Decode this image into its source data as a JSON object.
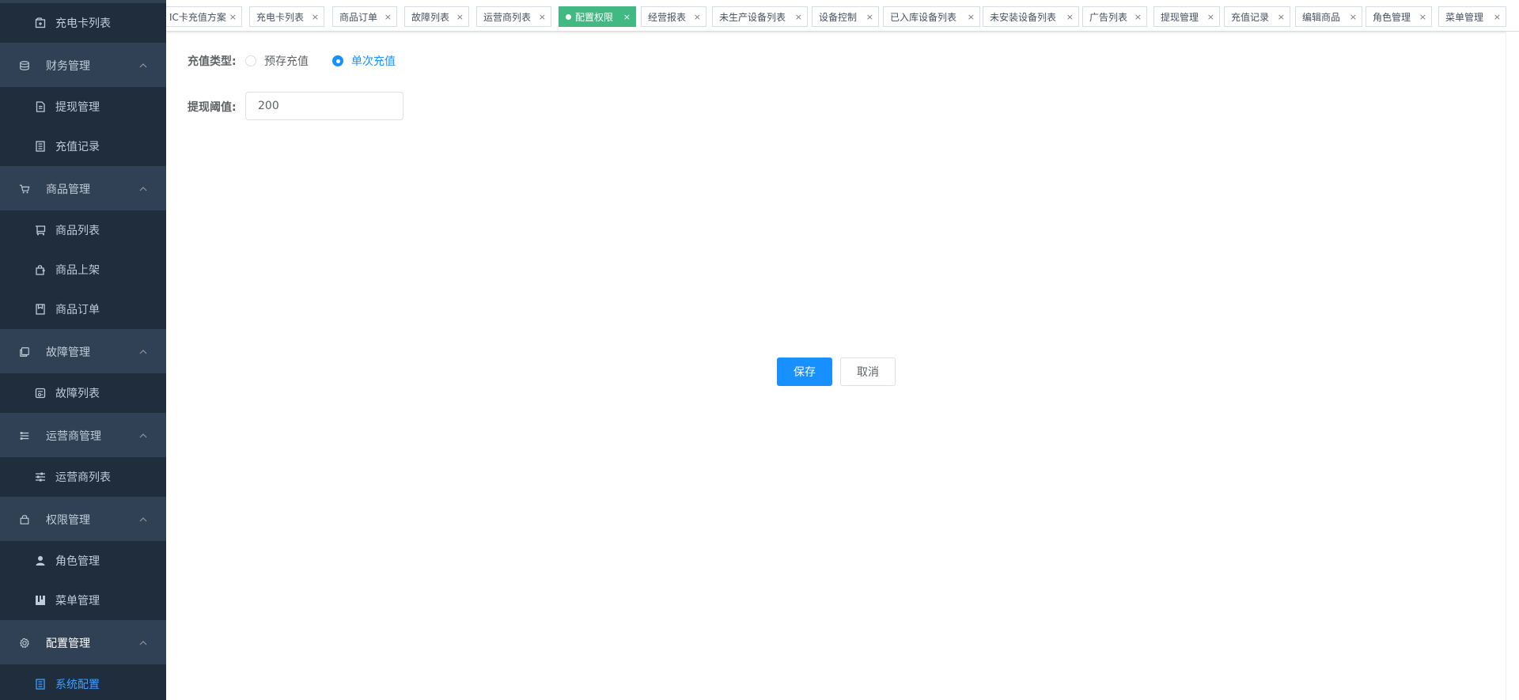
{
  "sidebar": {
    "items": [
      {
        "label": "充电卡列表",
        "icon": "card-list-icon"
      },
      {
        "label": "财务管理",
        "icon": "database-icon"
      },
      {
        "label": "提现管理",
        "icon": "document-icon"
      },
      {
        "label": "充值记录",
        "icon": "record-icon"
      },
      {
        "label": "商品管理",
        "icon": "cart-icon"
      },
      {
        "label": "商品列表",
        "icon": "cart-list-icon"
      },
      {
        "label": "商品上架",
        "icon": "shelf-icon"
      },
      {
        "label": "商品订单",
        "icon": "order-icon"
      },
      {
        "label": "故障管理",
        "icon": "copy-icon"
      },
      {
        "label": "故障列表",
        "icon": "fault-list-icon"
      },
      {
        "label": "运营商管理",
        "icon": "operator-icon"
      },
      {
        "label": "运营商列表",
        "icon": "sliders-icon"
      },
      {
        "label": "权限管理",
        "icon": "lock-icon"
      },
      {
        "label": "角色管理",
        "icon": "user-icon"
      },
      {
        "label": "菜单管理",
        "icon": "menu-icon"
      },
      {
        "label": "配置管理",
        "icon": "gear-icon"
      },
      {
        "label": "系统配置",
        "icon": "system-config-icon"
      }
    ]
  },
  "tags": [
    {
      "label": "IC卡充值方案"
    },
    {
      "label": "充电卡列表"
    },
    {
      "label": "商品订单"
    },
    {
      "label": "故障列表"
    },
    {
      "label": "运营商列表"
    },
    {
      "label": "配置权限"
    },
    {
      "label": "经营报表"
    },
    {
      "label": "未生产设备列表"
    },
    {
      "label": "设备控制"
    },
    {
      "label": "已入库设备列表"
    },
    {
      "label": "未安装设备列表"
    },
    {
      "label": "广告列表"
    },
    {
      "label": "提现管理"
    },
    {
      "label": "充值记录"
    },
    {
      "label": "编辑商品"
    },
    {
      "label": "角色管理"
    },
    {
      "label": "菜单管理"
    }
  ],
  "tag_close_glyph": "×",
  "form": {
    "recharge_type_label": "充值类型:",
    "recharge_options": [
      {
        "label": "预存充值",
        "checked": false
      },
      {
        "label": "单次充值",
        "checked": true
      }
    ],
    "withdraw_threshold_label": "提现阈值:",
    "withdraw_threshold_value": "200"
  },
  "actions": {
    "save_label": "保存",
    "cancel_label": "取消"
  },
  "colors": {
    "sidebar_bg": "#304156",
    "submenu_bg": "#1f2d3d",
    "active_tag": "#42b983",
    "primary": "#1890ff",
    "menu_active_text": "#409eff"
  }
}
